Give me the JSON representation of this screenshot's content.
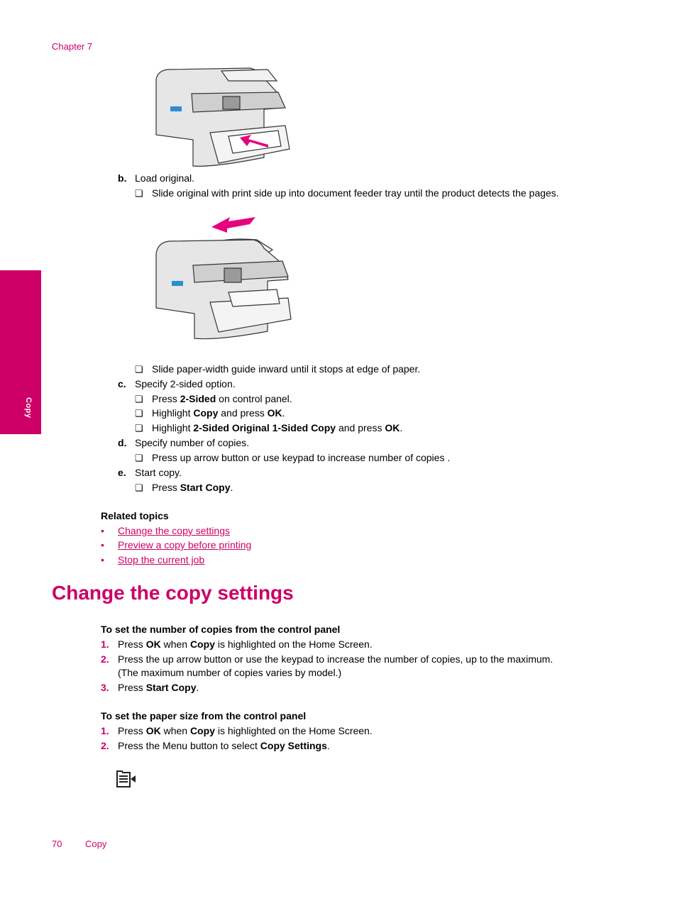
{
  "header": {
    "chapter": "Chapter 7"
  },
  "side_tab": {
    "label": "Copy",
    "color": "#cc0066"
  },
  "steps": {
    "b": {
      "letter": "b",
      "text": "Load original.",
      "items": [
        {
          "text": "Slide original with print side up into document feeder tray until the product detects the pages."
        },
        {
          "text": "Slide paper-width guide inward until it stops at edge of paper."
        }
      ]
    },
    "c": {
      "letter": "c",
      "text": "Specify 2-sided option.",
      "items": [
        {
          "pre": "Press ",
          "b1": "2-Sided",
          "mid": " on control panel.",
          "b2": "",
          "post": ""
        },
        {
          "pre": "Highlight ",
          "b1": "Copy",
          "mid": " and press ",
          "b2": "OK",
          "post": "."
        },
        {
          "pre": "Highlight ",
          "b1": "2-Sided Original 1-Sided Copy",
          "mid": " and press ",
          "b2": "OK",
          "post": "."
        }
      ]
    },
    "d": {
      "letter": "d",
      "text": "Specify number of copies.",
      "items": [
        {
          "text": "Press up arrow button or use keypad to increase number of copies ."
        }
      ]
    },
    "e": {
      "letter": "e",
      "text": "Start copy.",
      "items": [
        {
          "pre": "Press ",
          "b1": "Start Copy",
          "post": "."
        }
      ]
    }
  },
  "related": {
    "heading": "Related topics",
    "bullet": "•",
    "links": [
      "Change the copy settings",
      "Preview a copy before printing",
      "Stop the current job"
    ]
  },
  "section": {
    "title": "Change the copy settings",
    "procedures": [
      {
        "heading": "To set the number of copies from the control panel",
        "steps": [
          {
            "num": "1.",
            "pre": "Press ",
            "b1": "OK",
            "mid": " when ",
            "b2": "Copy",
            "post": " is highlighted on the Home Screen."
          },
          {
            "num": "2.",
            "line1": "Press the up arrow button or use the keypad to increase the number of copies, up to the maximum.",
            "line2": "(The maximum number of copies varies by model.)"
          },
          {
            "num": "3.",
            "pre": "Press ",
            "b1": "Start Copy",
            "post": "."
          }
        ]
      },
      {
        "heading": "To set the paper size from the control panel",
        "steps": [
          {
            "num": "1.",
            "pre": "Press ",
            "b1": "OK",
            "mid": " when ",
            "b2": "Copy",
            "post": " is highlighted on the Home Screen."
          },
          {
            "num": "2.",
            "pre": "Press the Menu button to select ",
            "b1": "Copy Settings",
            "post": "."
          }
        ]
      }
    ],
    "menu_icon": "menu-button-icon"
  },
  "footer": {
    "page_number": "70",
    "section": "Copy"
  },
  "colors": {
    "accent": "#cc0066",
    "text": "#000000",
    "printer_body": "#e6e6e6",
    "printer_blue": "#2a8fd0"
  }
}
